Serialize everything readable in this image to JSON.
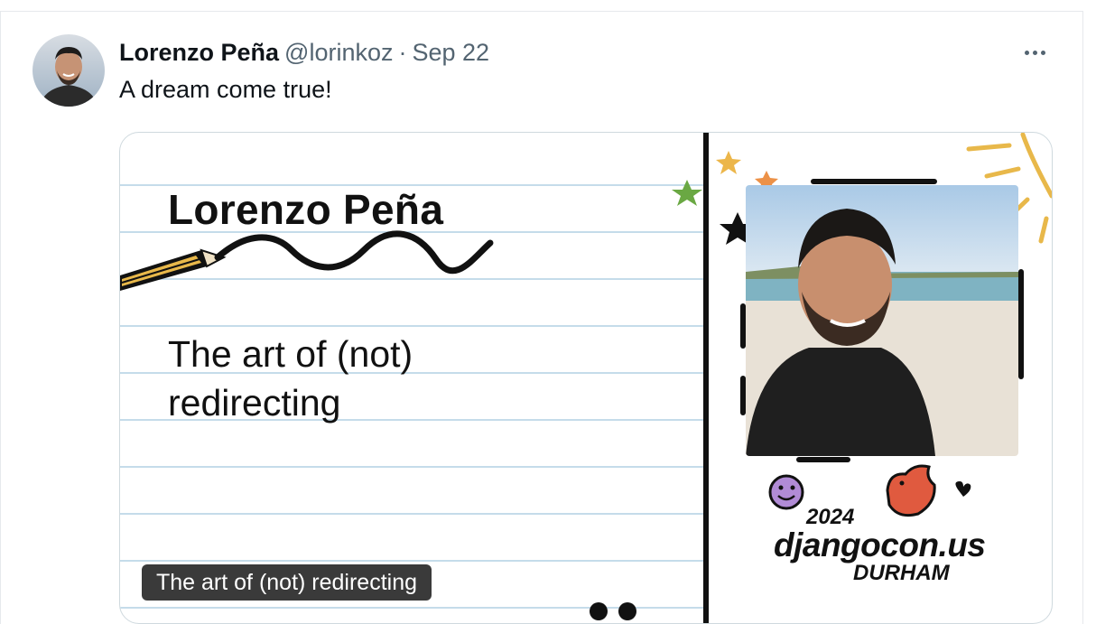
{
  "tweet": {
    "author_name": "Lorenzo Peña",
    "handle": "@lorinkoz",
    "separator": "·",
    "date": "Sep 22",
    "text": "A dream come true!"
  },
  "card": {
    "speaker_name": "Lorenzo Peña",
    "talk_title": "The art of (not) redirecting",
    "event_year": "2024",
    "event_name": "djangocon.us",
    "event_city": "DURHAM",
    "media_caption": "The art of (not) redirecting"
  },
  "icons": {
    "more": "more-horizontal-icon"
  },
  "colors": {
    "text_primary": "#0f1419",
    "text_secondary": "#536471",
    "card_border": "#cfd9de",
    "notebook_line": "#c5dcea",
    "caption_bg": "#3a3a3a"
  }
}
